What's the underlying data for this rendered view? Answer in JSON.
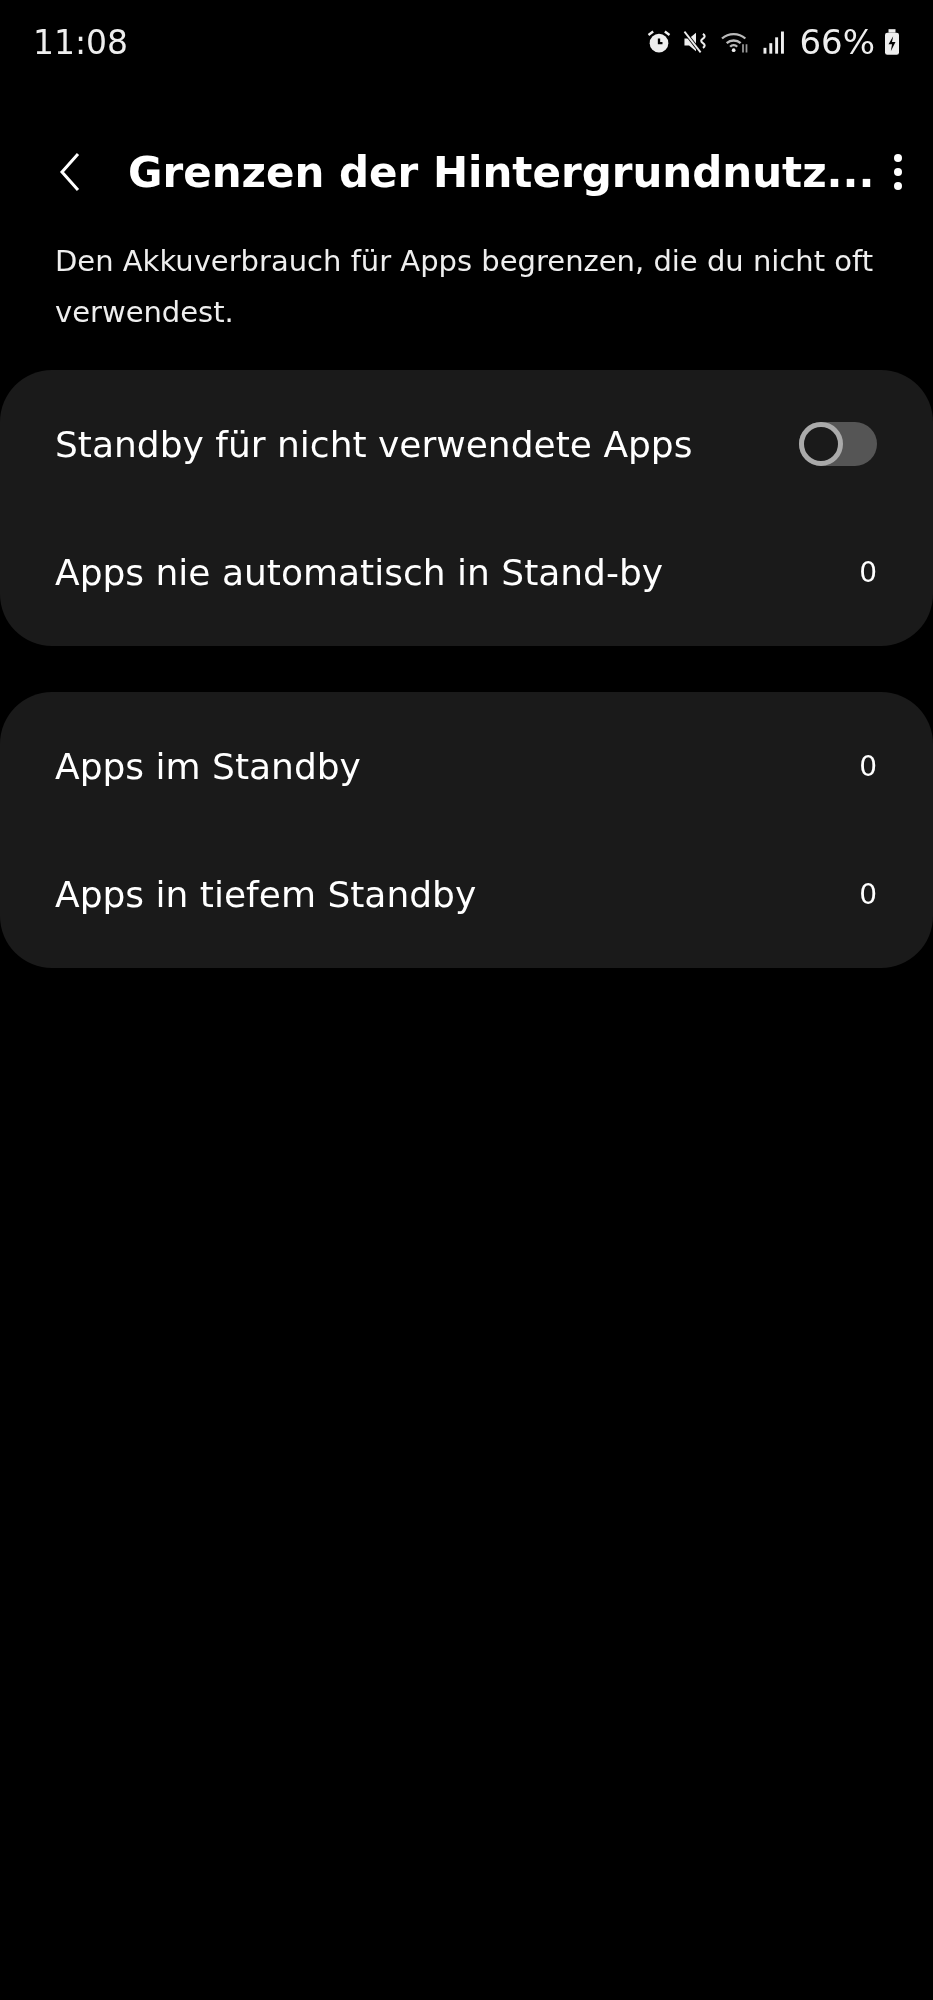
{
  "status_bar": {
    "time": "11:08",
    "battery": "66%"
  },
  "header": {
    "title": "Grenzen der Hintergrundnutz..."
  },
  "description": "Den Akkuverbrauch für Apps begrenzen, die du nicht oft verwendest.",
  "groups": [
    {
      "items": [
        {
          "kind": "switch",
          "label": "Standby für nicht verwendete Apps",
          "on": false
        },
        {
          "kind": "count",
          "label": "Apps nie automatisch in Stand-by",
          "value": "0"
        }
      ]
    },
    {
      "items": [
        {
          "kind": "count",
          "label": "Apps im Standby",
          "value": "0"
        },
        {
          "kind": "count",
          "label": "Apps in tiefem Standby",
          "value": "0"
        }
      ]
    }
  ]
}
